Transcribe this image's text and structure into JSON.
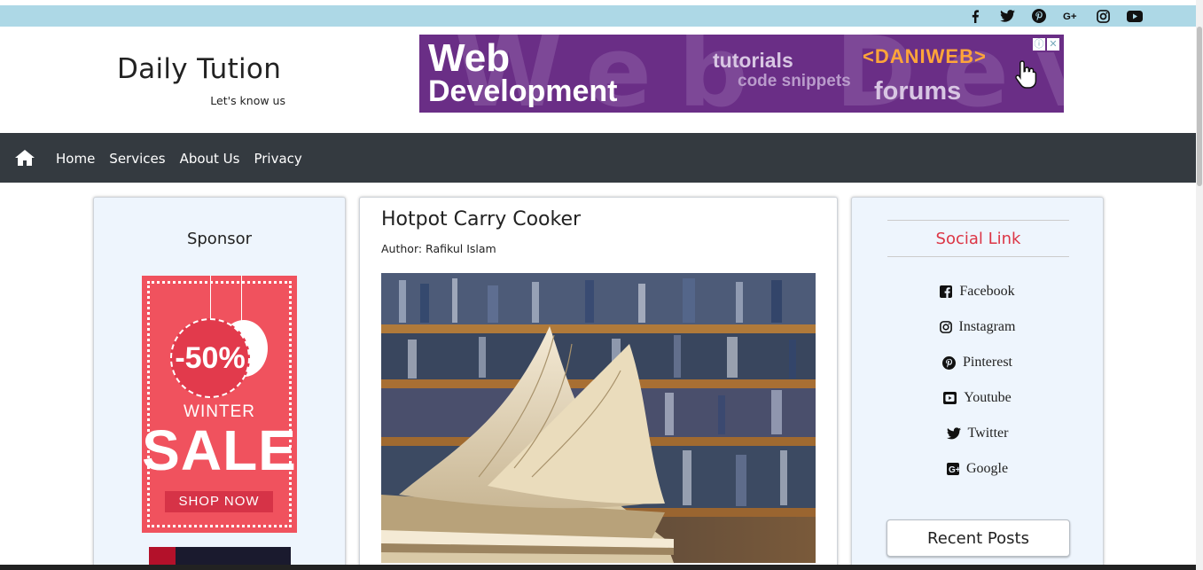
{
  "site": {
    "title": "Daily Tution",
    "tagline": "Let's know us"
  },
  "top_social_icons": [
    "facebook-icon",
    "twitter-icon",
    "pinterest-icon",
    "google-plus-icon",
    "instagram-icon",
    "youtube-icon"
  ],
  "header_ad": {
    "line1": "Web",
    "line2": "Development",
    "background_word": "Web Devel",
    "tutorials": "tutorials",
    "code_snippets": "code snippets",
    "forums": "forums",
    "logo": "DANIWEB",
    "adchoices": "ⓘ",
    "close": "✕"
  },
  "nav": {
    "home_icon": "home-icon",
    "items": [
      {
        "label": "Home"
      },
      {
        "label": "Services"
      },
      {
        "label": "About Us"
      },
      {
        "label": "Privacy"
      }
    ]
  },
  "left_sidebar": {
    "title": "Sponsor",
    "sale_ad": {
      "discount": "-50%",
      "season": "WINTER",
      "headline": "SALE",
      "cta": "SHOP NOW"
    }
  },
  "post": {
    "title": "Hotpot Carry Cooker",
    "author": "Author: Rafikul Islam",
    "image_icon": "open-book-in-library-image"
  },
  "right_sidebar": {
    "title": "Social Link",
    "links": [
      {
        "label": "Facebook",
        "icon": "facebook-square-icon"
      },
      {
        "label": "Instagram",
        "icon": "instagram-icon"
      },
      {
        "label": "Pinterest",
        "icon": "pinterest-icon"
      },
      {
        "label": "Youtube",
        "icon": "youtube-square-icon"
      },
      {
        "label": "Twitter",
        "icon": "twitter-icon"
      },
      {
        "label": "Google",
        "icon": "google-square-icon"
      }
    ],
    "recent_posts_label": "Recent Posts"
  },
  "colors": {
    "topbar": "#add8e6",
    "navbar": "#343a40",
    "sidebar_bg": "#eef5fd",
    "social_title": "#dc3545",
    "ad_purple": "#6a2e86",
    "sale_pink": "#f0525e"
  }
}
